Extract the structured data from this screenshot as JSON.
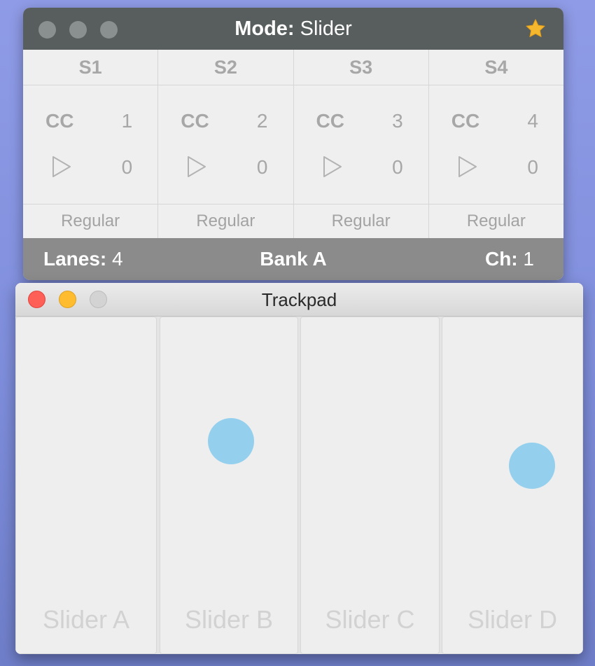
{
  "top_window": {
    "mode_label": "Mode:",
    "mode_value": "Slider",
    "star_icon": "star-icon",
    "star_color": "#f5b72d",
    "lanes": [
      {
        "header": "S1",
        "cc_label": "CC",
        "cc_number": "1",
        "play_icon": "play-icon",
        "value": "0",
        "mode": "Regular"
      },
      {
        "header": "S2",
        "cc_label": "CC",
        "cc_number": "2",
        "play_icon": "play-icon",
        "value": "0",
        "mode": "Regular"
      },
      {
        "header": "S3",
        "cc_label": "CC",
        "cc_number": "3",
        "play_icon": "play-icon",
        "value": "0",
        "mode": "Regular"
      },
      {
        "header": "S4",
        "cc_label": "CC",
        "cc_number": "4",
        "play_icon": "play-icon",
        "value": "0",
        "mode": "Regular"
      }
    ],
    "status": {
      "lanes_label": "Lanes:",
      "lanes_value": "4",
      "bank": "Bank A",
      "channel_label": "Ch:",
      "channel_value": "1"
    }
  },
  "trackpad_window": {
    "title": "Trackpad",
    "touch_color": "#94d0ee",
    "sliders": [
      {
        "label": "Slider A"
      },
      {
        "label": "Slider B"
      },
      {
        "label": "Slider C"
      },
      {
        "label": "Slider D"
      }
    ]
  }
}
